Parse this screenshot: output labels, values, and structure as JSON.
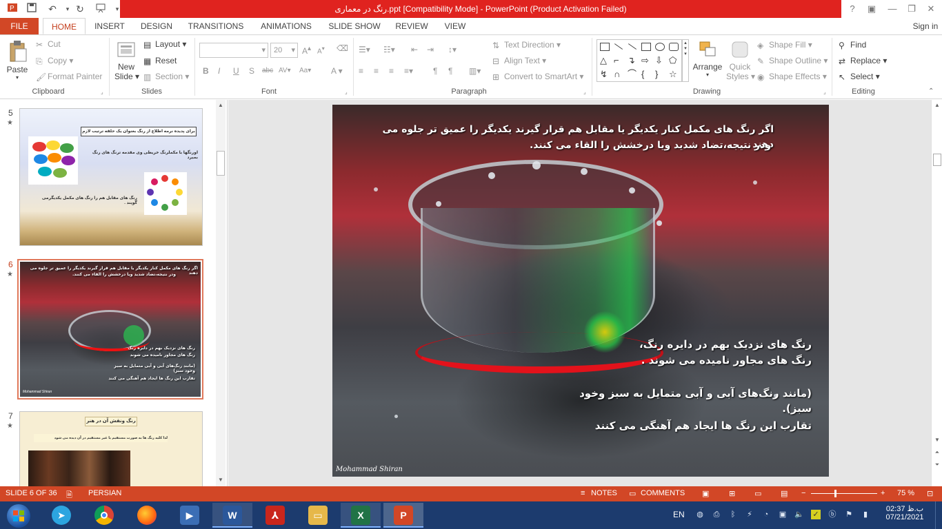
{
  "window": {
    "title": "رنگ در معماری.ppt [Compatibility Mode] -  PowerPoint (Product Activation Failed)",
    "help": "?",
    "signin": "Sign in"
  },
  "tabs": [
    "FILE",
    "HOME",
    "INSERT",
    "DESIGN",
    "TRANSITIONS",
    "ANIMATIONS",
    "SLIDE SHOW",
    "REVIEW",
    "VIEW"
  ],
  "ribbon": {
    "clipboard": {
      "paste": "Paste",
      "cut": "Cut",
      "copy": "Copy",
      "format_painter": "Format Painter",
      "label": "Clipboard"
    },
    "slides": {
      "new_slide_1": "New",
      "new_slide_2": "Slide",
      "layout": "Layout",
      "reset": "Reset",
      "section": "Section",
      "label": "Slides"
    },
    "font": {
      "size": "20",
      "label": "Font",
      "bold": "B",
      "italic": "I",
      "underline": "U",
      "shadow": "S",
      "strike": "abc"
    },
    "paragraph": {
      "text_direction": "Text Direction",
      "align_text": "Align Text",
      "convert_smartart": "Convert to SmartArt",
      "label": "Paragraph"
    },
    "drawing": {
      "arrange": "Arrange",
      "quick_styles_1": "Quick",
      "quick_styles_2": "Styles",
      "shape_fill": "Shape Fill",
      "shape_outline": "Shape Outline",
      "shape_effects": "Shape Effects",
      "label": "Drawing"
    },
    "editing": {
      "find": "Find",
      "replace": "Replace",
      "select": "Select",
      "label": "Editing"
    }
  },
  "thumbnails": [
    {
      "number": "5",
      "star": "★",
      "line1": "برای پدیده نرمه اطلاع از رنگ بعنوان یک حلقه ترتیب لازم است.",
      "line2": "اورنگها با مکملرنگ خریطی وی مقدمه ترنگ های رنگ بمیرد",
      "line3": "رنگ های مقابل هم را رنگ های مکمل یکدیگرمی گویند ."
    },
    {
      "number": "6",
      "star": "★",
      "line1": "اگر رنگ های مکمل کنار یکدیگر یا مقابل هم قرار گیرند یکدیگر را عمیق تر جلوه می دهند",
      "line2": "ودر نتیجه،تضاد شدید ویا درخشش را القاء می کنند.",
      "line3": "رنگ های نزدیک بهم در دایره رنگ",
      "line4": "رنگ های مجاور نامیده می شوند",
      "line5": "(مانند رنگ‌های آبی و آبی متمایل به سبز وخود سبز)",
      "line6": "تقارب این رنگ ها ایجاد هم آهنگی می کنند",
      "credit": "Mohammad Shiran"
    },
    {
      "number": "7",
      "star": "★",
      "line1": "رنگ ونقش آن در هنر",
      "line2": "لذا کلیه رنگ ها به صورت مستقیم یا غیر مستقیم در آن دیده می شود"
    }
  ],
  "slide": {
    "top_line1": "اگر رنگ های مکمل کنار یکدیگر یا مقابل هم قرار گیرند یکدیگر را عمیق تر جلوه می دهند",
    "top_line2": "ودر نتیجه،تضاد شدید ویا درخشش را القاء می کنند.",
    "mid_line1": "رنگ های نزدیک بهم در دایره رنگ،",
    "mid_line2": "رنگ های مجاور نامیده می شوند .",
    "mid_line3": "(مانند رنگ‌های آبی و آبی متمایل به سبز وخود سبز).",
    "mid_line4": "تقارب این رنگ ها ایجاد هم آهنگی می کنند",
    "credit": "Mohammad Shiran"
  },
  "status": {
    "slide_info": "SLIDE 6 OF 36",
    "language": "PERSIAN",
    "notes": "NOTES",
    "comments": "COMMENTS",
    "zoom": "75 %"
  },
  "taskbar": {
    "lang": "EN",
    "time": "02:37 ب.ظ",
    "date": "07/21/2021"
  },
  "colors": {
    "accent": "#d24726",
    "titlebar_red": "#e0231f",
    "taskbar": "#1c3b6e"
  }
}
